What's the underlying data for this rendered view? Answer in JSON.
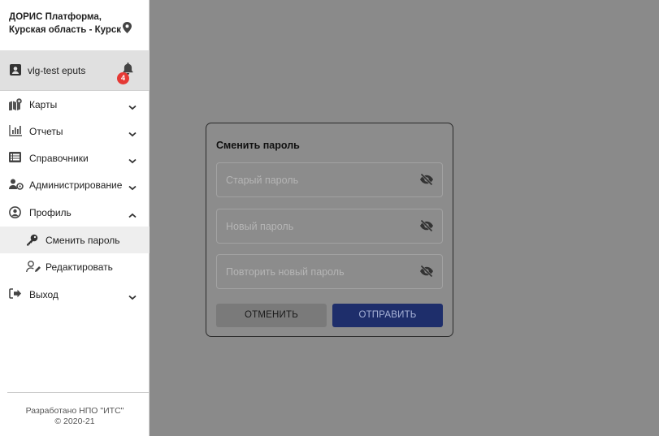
{
  "sidebar": {
    "header": {
      "line1": "ДОРИС Платформа,",
      "line2": "Курская область - Курск",
      "pin_icon": "map-pin-icon"
    },
    "user": {
      "name": "vlg-test eputs",
      "notification_count": "4"
    },
    "items": [
      {
        "label": "Карты",
        "icon": "map-icon",
        "expanded": false
      },
      {
        "label": "Отчеты",
        "icon": "bar-chart-icon",
        "expanded": false
      },
      {
        "label": "Справочники",
        "icon": "list-icon",
        "expanded": false
      },
      {
        "label": "Администрирование",
        "icon": "users-cog-icon",
        "expanded": false
      },
      {
        "label": "Профиль",
        "icon": "user-circle-icon",
        "expanded": true,
        "children": [
          {
            "label": "Сменить пароль",
            "icon": "key-icon",
            "active": true
          },
          {
            "label": "Редактировать",
            "icon": "user-edit-icon",
            "active": false
          }
        ]
      },
      {
        "label": "Выход",
        "icon": "sign-out-icon",
        "expanded": false
      }
    ],
    "footer": {
      "line1": "Разработано НПО \"ИТС\"",
      "line2": "© 2020-21"
    }
  },
  "dialog": {
    "title": "Сменить пароль",
    "fields": [
      {
        "placeholder": "Старый пароль",
        "value": ""
      },
      {
        "placeholder": "Новый пароль",
        "value": ""
      },
      {
        "placeholder": "Повторить новый пароль",
        "value": ""
      }
    ],
    "cancel_label": "ОТМЕНИТЬ",
    "submit_label": "ОТПРАВИТЬ"
  },
  "colors": {
    "overlay": "#8a8a8a",
    "primary": "#1e2e6b",
    "badge": "#e53935"
  }
}
